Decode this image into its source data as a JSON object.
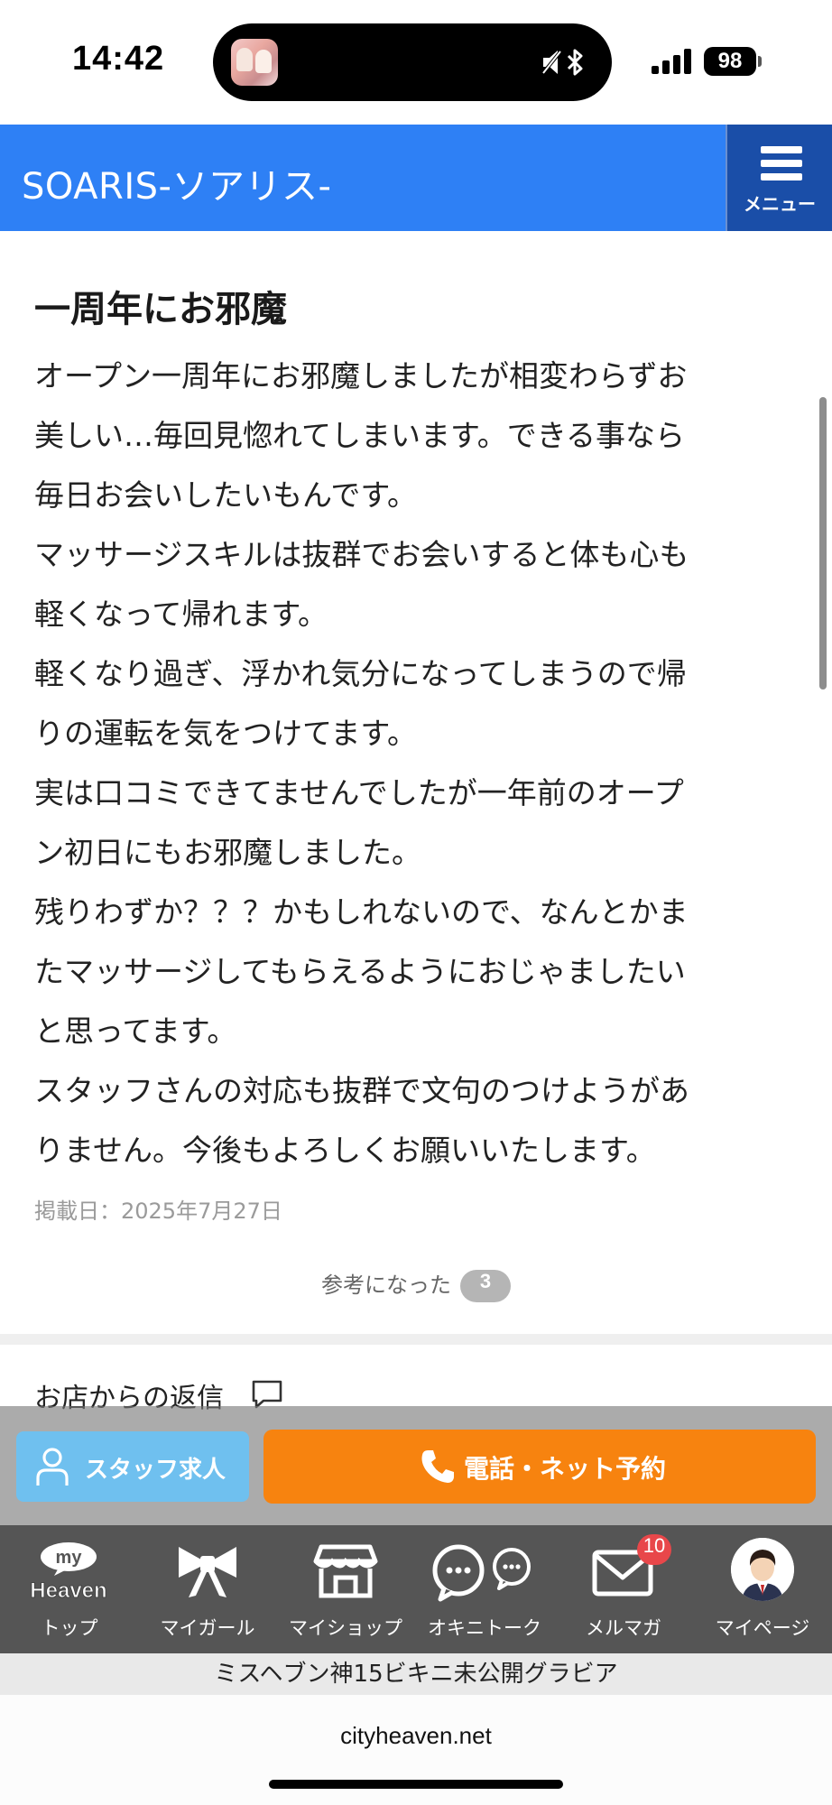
{
  "status_bar": {
    "time": "14:42",
    "battery": "98",
    "icons": [
      "app-thumbnail-icon",
      "silent-mode-icon",
      "bluetooth-icon",
      "signal-icon",
      "battery-icon"
    ]
  },
  "header": {
    "site_title": "SOARIS-ソアリス-",
    "menu_label": "メニュー",
    "brand_color": "#2e80f5",
    "menu_color": "#1a4ea8"
  },
  "review": {
    "title": "一周年にお邪魔",
    "body_lines": [
      "オープン一周年にお邪魔しましたが相変わらずお",
      "美しい…毎回見惚れてしまいます。できる事なら",
      "毎日お会いしたいもんです。",
      "マッサージスキルは抜群でお会いすると体も心も",
      "軽くなって帰れます。",
      "軽くなり過ぎ、浮かれ気分になってしまうので帰",
      "りの運転を気をつけてます。",
      "実は口コミできてませんでしたが一年前のオープ",
      "ン初日にもお邪魔しました。",
      "残りわずか？？？かもしれないので、なんとかま",
      "たマッサージしてもらえるようにおじゃましたい",
      "と思ってます。",
      "スタッフさんの対応も抜群で文句のつけようがあ",
      "りません。今後もよろしくお願いいたします。"
    ],
    "post_date": "掲載日：2025年7月27日",
    "helpful_label": "参考になった",
    "helpful_count": "3"
  },
  "shop_reply": {
    "heading": "お店からの返信"
  },
  "cta": {
    "staff_recruit_label": "スタッフ求人",
    "call_reserve_label": "電話・ネット予約",
    "staff_color": "#6fc0ef",
    "call_color": "#f7830f"
  },
  "bottom_nav": {
    "logo_top": "my",
    "logo_bottom": "Heaven",
    "items": [
      {
        "label": "トップ",
        "icon": "my-heaven-logo-icon"
      },
      {
        "label": "マイガール",
        "icon": "ribbon-icon"
      },
      {
        "label": "マイショップ",
        "icon": "storefront-icon"
      },
      {
        "label": "オキニトーク",
        "icon": "chat-bubbles-icon"
      },
      {
        "label": "メルマガ",
        "icon": "mail-icon"
      },
      {
        "label": "マイページ",
        "icon": "avatar-icon"
      }
    ],
    "mail_badge": "10"
  },
  "ad_banner": {
    "text": "ミスヘブン神15ビキニ未公開グラビア"
  },
  "browser": {
    "domain": "cityheaven.net"
  }
}
